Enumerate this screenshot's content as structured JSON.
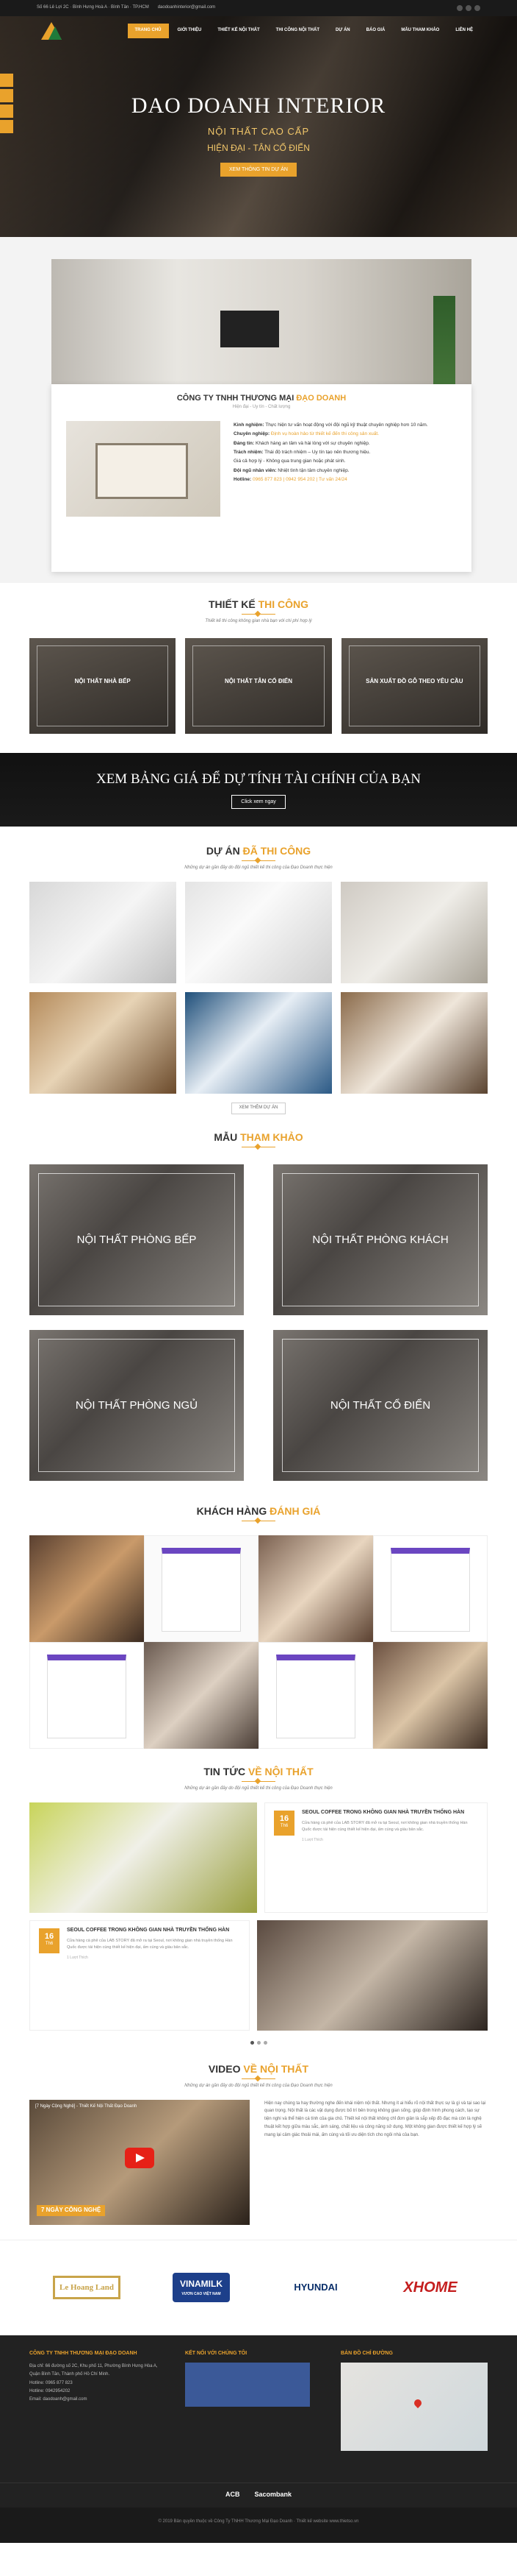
{
  "topbar": {
    "address": "Số 66 Lê Lợi 2C · Bình Hưng Hoà A · Bình Tân · TP.HCM",
    "email": "daodoanhinterior@gmail.com"
  },
  "nav": [
    "TRANG CHỦ",
    "GIỚI THIỆU",
    "THIẾT KẾ NỘI THẤT",
    "THI CÔNG NỘI THẤT",
    "DỰ ÁN",
    "BÁO GIÁ",
    "MẪU THAM KHẢO",
    "LIÊN HỆ"
  ],
  "hero": {
    "title": "DAO DOANH INTERIOR",
    "line1": "NỘI THẤT CAO CẤP",
    "line2": "HIỆN ĐẠI - TÂN CỔ ĐIỂN",
    "button": "XEM THÔNG TIN DỰ ÁN"
  },
  "about": {
    "title_a": "CÔNG TY TNHH THƯƠNG MẠI ",
    "title_b": "ĐẠO DOANH",
    "tagline": "Hiện đại - Uy tín - Chất lượng",
    "items": [
      {
        "k": "Kinh nghiệm:",
        "v": " Thực hiện tư vấn hoạt động với đội ngũ kỹ thuật chuyên nghiệp hơn 10 năm."
      },
      {
        "k": "Chuyên nghiệp:",
        "v": " Định vụ hoàn hảo từ thiết kế đến thi công sản xuất."
      },
      {
        "k": "Đáng tin:",
        "v": " Khách hàng an tâm và hài lòng với sự chuyên nghiệp."
      },
      {
        "k": "Trách nhiệm:",
        "v": " Thái độ trách nhiệm – Uy tín tạo nên thương hiệu."
      },
      {
        "k": "",
        "v": "Giá cả hợp lý - Không qua trung gian hoặc phát sinh."
      },
      {
        "k": "Đội ngũ nhân viên:",
        "v": " Nhiệt tình tận tâm chuyên nghiệp."
      },
      {
        "k": "Hotline:",
        "v": " 0965 877 823 | 0942 954 202 | Tư vấn 24/24"
      }
    ]
  },
  "design": {
    "title_a": "THIẾT KẾ ",
    "title_b": "THI CÔNG",
    "sub": "Thiết kế thi công không gian nhà bạn với chi phí hợp lý",
    "items": [
      "NỘI THẤT NHÀ BẾP",
      "NỘI THẤT TÂN CỔ ĐIỂN",
      "SẢN XUẤT ĐỒ GỖ THEO YÊU CẦU"
    ]
  },
  "cta": {
    "title": "XEM BẢNG GIÁ ĐỂ DỰ TÍNH TÀI CHÍNH CỦA BẠN",
    "button": "Click xem ngay"
  },
  "projects": {
    "title_a": "DỰ ÁN ",
    "title_b": "ĐÃ THI CÔNG",
    "sub": "Những dự án gần đây do đội ngũ thiết kế thi công của Đạo Doanh thực hiện",
    "more": "XEM THÊM DỰ ÁN"
  },
  "samples": {
    "title_a": "MẪU ",
    "title_b": "THAM KHẢO",
    "items": [
      "NỘI THẤT PHÒNG BẾP",
      "NỘI THẤT PHÒNG KHÁCH",
      "NỘI THẤT PHÒNG NGỦ",
      "NỘI THẤT CỔ ĐIỂN"
    ]
  },
  "reviews": {
    "title_a": "KHÁCH HÀNG ",
    "title_b": "ĐÁNH GIÁ"
  },
  "news": {
    "title_a": "TIN TỨC ",
    "title_b": "VỀ NỘI THẤT",
    "sub": "Những dự án gần đây do đội ngũ thiết kế thi công của Đạo Doanh thực hiện",
    "posts": [
      {
        "day": "16",
        "mon": "Th6",
        "title": "SEOUL COFFEE TRONG KHÔNG GIAN NHÀ TRUYỀN THỐNG HÀN",
        "text": "Cửa hàng cà phê của LAB STORY đã mở ra tại Seoul, nơi không gian nhà truyền thống Hàn Quốc được tái hiện cùng thiết kế hiện đại, ấm cúng và giàu bản sắc.",
        "meta": "1 Lượt Thích"
      },
      {
        "day": "16",
        "mon": "Th6",
        "title": "SEOUL COFFEE TRONG KHÔNG GIAN NHÀ TRUYỀN THỐNG HÀN",
        "text": "Cửa hàng cà phê của LAB STORY đã mở ra tại Seoul, nơi không gian nhà truyền thống Hàn Quốc được tái hiện cùng thiết kế hiện đại, ấm cúng và giàu bản sắc.",
        "meta": "1 Lượt Thích"
      }
    ]
  },
  "video": {
    "title_a": "VIDEO ",
    "title_b": "VỀ NỘI THẤT",
    "sub": "Những dự án gần đây do đội ngũ thiết kế thi công của Đạo Doanh thực hiện",
    "vtitle": "[7 Ngày Cộng Nghệ] - Thiết Kế Nội Thất Đạo Doanh",
    "badge": "7 NGÀY CÔNG NGHỆ",
    "text": "Hiện nay chúng ta hay thường nghe đến khái niệm nội thất. Nhưng ít ai hiểu rõ nội thất thực sự là gì và tại sao lại quan trọng. Nội thất là các vật dụng được bố trí bên trong không gian sống, giúp định hình phong cách, tạo sự tiện nghi và thể hiện cá tính của gia chủ. Thiết kế nội thất không chỉ đơn giản là sắp xếp đồ đạc mà còn là nghệ thuật kết hợp giữa màu sắc, ánh sáng, chất liệu và công năng sử dụng. Một không gian được thiết kế hợp lý sẽ mang lại cảm giác thoải mái, ấm cúng và tối ưu diện tích cho ngôi nhà của bạn."
  },
  "partners": [
    "Le Hoang Land",
    "VINAMILK",
    "VƯƠN CAO VIỆT NAM",
    "HYUNDAI",
    "XHOME"
  ],
  "footer": {
    "c1_title": "CÔNG TY TNHH THƯƠNG MẠI ĐẠO DOANH",
    "c1_lines": [
      "Địa chỉ: 66 đường số 2C, Khu phố 11, Phường Bình Hưng Hòa A,",
      "Quận Bình Tân, Thành phố Hồ Chí Minh.",
      "Hotline: 0965 877 823",
      "Hotline: 0942954202",
      "Email: daodoanh@gmail.com"
    ],
    "c2_title": "KẾT NỐI VỚI CHÚNG TÔI",
    "c3_title": "BẢN ĐỒ CHỈ ĐƯỜNG",
    "banks": [
      "ACB",
      "Sacombank"
    ],
    "copy": "© 2019 Bản quyền thuộc về Công Ty TNHH Thương Mại Đạo Doanh · Thiết kế website www.thietso.vn"
  }
}
